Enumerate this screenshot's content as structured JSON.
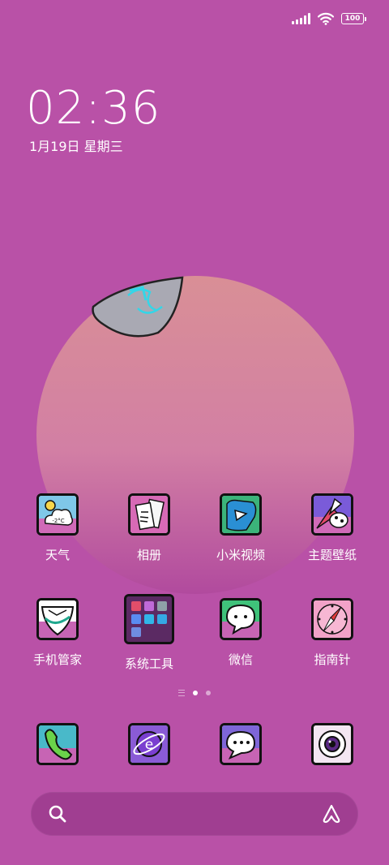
{
  "status": {
    "battery": "100"
  },
  "lockscreen": {
    "time": "02:36",
    "date": "1月19日 星期三"
  },
  "apps": [
    {
      "label": "天气",
      "icon": "weather-icon"
    },
    {
      "label": "相册",
      "icon": "gallery-icon"
    },
    {
      "label": "小米视频",
      "icon": "mi-video-icon"
    },
    {
      "label": "主题壁纸",
      "icon": "themes-icon"
    },
    {
      "label": "手机管家",
      "icon": "security-icon"
    },
    {
      "label": "系统工具",
      "icon": "tools-folder-icon"
    },
    {
      "label": "微信",
      "icon": "wechat-icon"
    },
    {
      "label": "指南针",
      "icon": "compass-icon"
    }
  ],
  "weather_icon_text": "-2°C",
  "dock": [
    {
      "icon": "phone-icon"
    },
    {
      "icon": "browser-icon"
    },
    {
      "icon": "messages-icon"
    },
    {
      "icon": "camera-icon"
    }
  ],
  "pages": {
    "count": 2,
    "current": 1
  },
  "colors": {
    "background": "#b951a7",
    "planet": "#d98aa0",
    "accent": "#ffffff"
  }
}
